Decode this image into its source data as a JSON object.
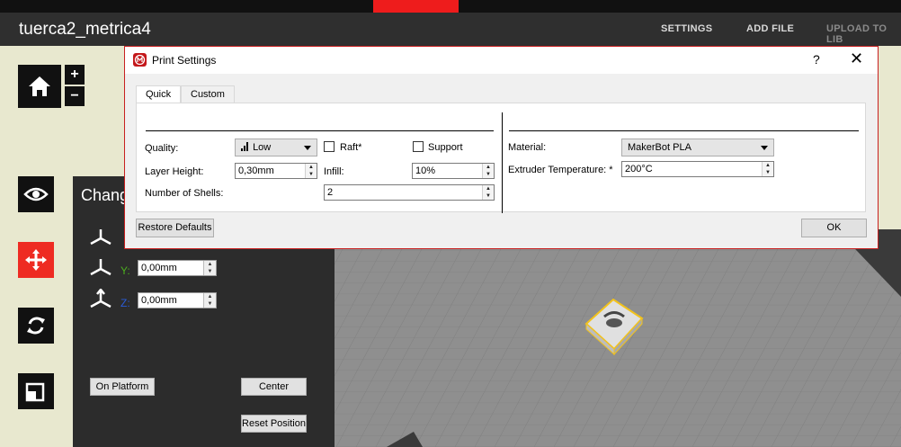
{
  "window": {
    "file_title": "tuerca2_metrica4",
    "menu": [
      "SETTINGS",
      "ADD FILE",
      "UPLOAD TO LIB"
    ]
  },
  "toolbar": {
    "zoom_in": "+",
    "zoom_out": "−",
    "tools": [
      "home-icon",
      "view-eye-icon",
      "move-icon",
      "rotate-icon",
      "scale-icon"
    ]
  },
  "change_panel": {
    "heading": "Chang",
    "y_label": "Y:",
    "y_value": "0,00mm",
    "z_label": "Z:",
    "z_value": "0,00mm",
    "on_platform": "On Platform",
    "center": "Center",
    "reset_position": "Reset Position",
    "colors": {
      "y": "#4caf1e",
      "z": "#2a5bd7"
    }
  },
  "dialog": {
    "title": "Print Settings",
    "help": "?",
    "close": "✕",
    "tabs": [
      "Quick",
      "Custom"
    ],
    "selected_tab": "Quick",
    "quality_label": "Quality:",
    "quality_value": "Low",
    "raft_label": "Raft*",
    "raft_checked": false,
    "support_label": "Support",
    "support_checked": false,
    "layer_height_label": "Layer Height:",
    "layer_height_value": "0,30mm",
    "infill_label": "Infill:",
    "infill_value": "10%",
    "shells_label": "Number of Shells:",
    "shells_value": "2",
    "material_label": "Material:",
    "material_value": "MakerBot PLA",
    "extruder_temp_label": "Extruder Temperature: *",
    "extruder_temp_value": "200°C",
    "restore_defaults": "Restore Defaults",
    "ok": "OK"
  },
  "colors": {
    "accent": "#ee2b22",
    "titlebar": "#2f2f2f",
    "panel": "#2c2c2c",
    "plate_grid": "#8c8c8c"
  }
}
